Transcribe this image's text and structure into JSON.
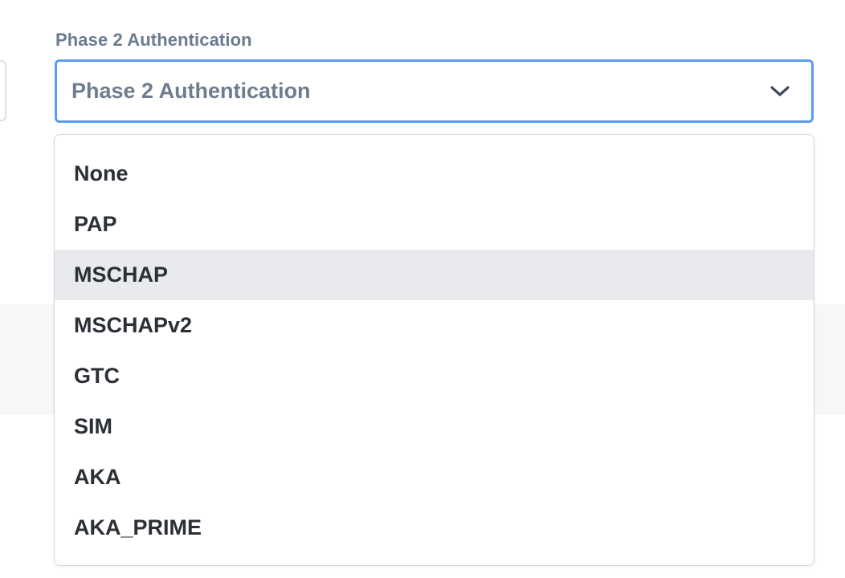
{
  "field": {
    "label": "Phase 2 Authentication",
    "selected_value": "Phase 2 Authentication"
  },
  "dropdown": {
    "options": [
      {
        "label": "None",
        "highlighted": false
      },
      {
        "label": "PAP",
        "highlighted": false
      },
      {
        "label": "MSCHAP",
        "highlighted": true
      },
      {
        "label": "MSCHAPv2",
        "highlighted": false
      },
      {
        "label": "GTC",
        "highlighted": false
      },
      {
        "label": "SIM",
        "highlighted": false
      },
      {
        "label": "AKA",
        "highlighted": false
      },
      {
        "label": "AKA_PRIME",
        "highlighted": false
      }
    ]
  },
  "colors": {
    "focus_border": "#5b9bf0",
    "label": "#6b7a90",
    "option_text": "#2b2f36",
    "highlight_bg": "#e9eaed"
  },
  "icons": {
    "chevron": "chevron-down-icon"
  }
}
